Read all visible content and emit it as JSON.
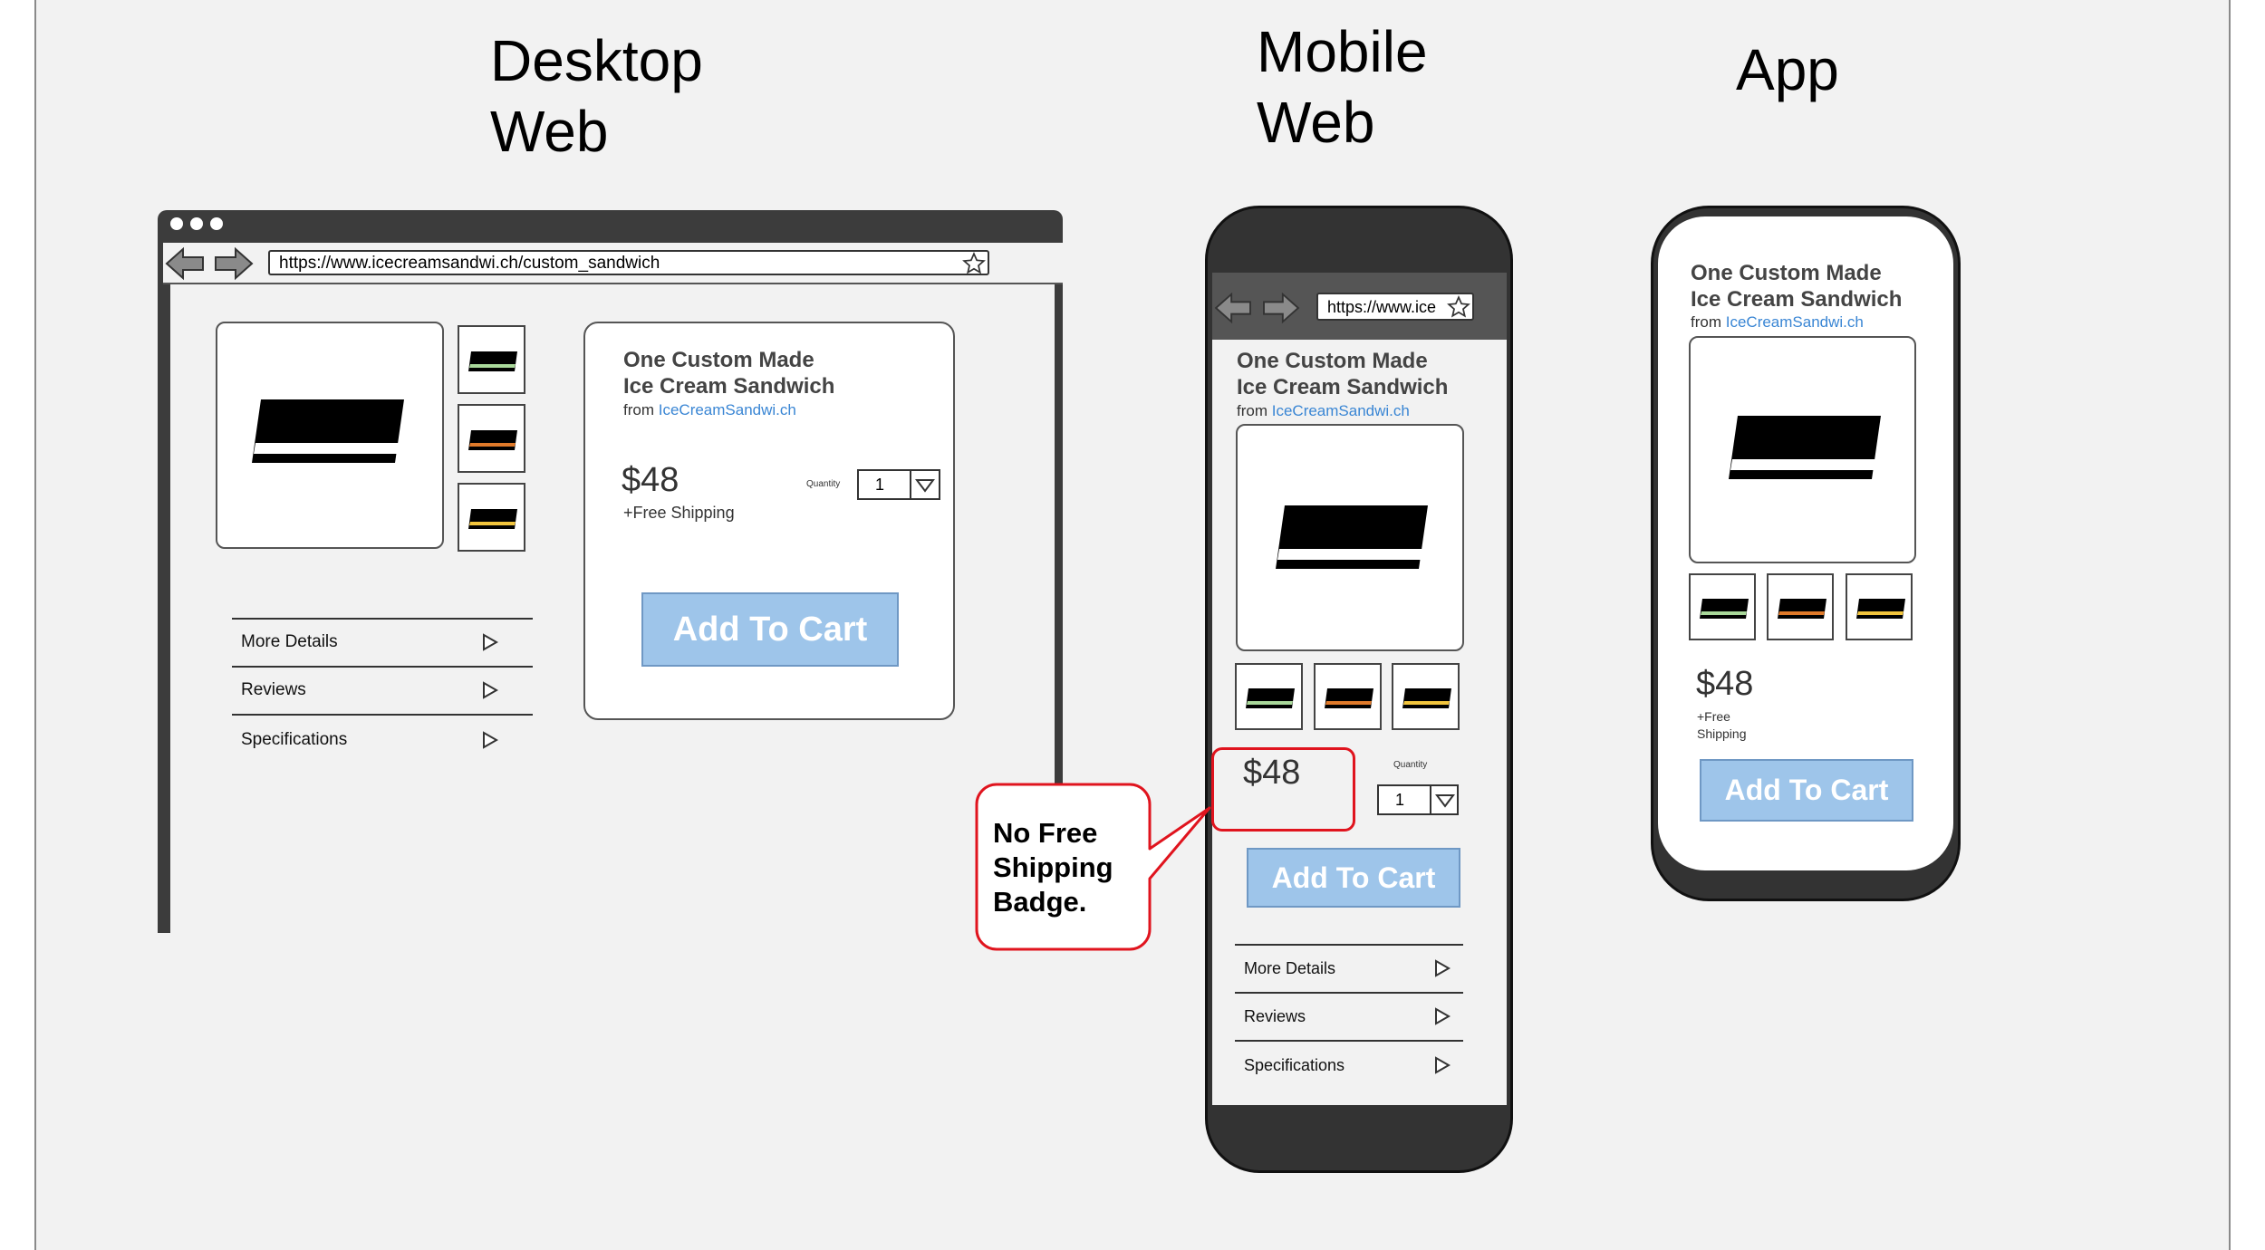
{
  "columns": {
    "desktop_heading": "Desktop\nWeb",
    "mobile_heading": "Mobile\nWeb",
    "app_heading": "App"
  },
  "product": {
    "title": "One Custom Made\nIce Cream Sandwich",
    "from_prefix": "from",
    "brand_link": "IceCreamSandwi.ch",
    "price": "$48",
    "shipping": "+Free Shipping",
    "shipping_app": "+Free\nShipping",
    "add_to_cart": "Add To Cart",
    "quantity_label": "Quantity",
    "quantity_value": "1"
  },
  "browser": {
    "desktop_url": "https://www.icecreamsandwi.ch/custom_sandwich",
    "mobile_url": "https://www.ice"
  },
  "accordion": [
    "More Details",
    "Reviews",
    "Specifications"
  ],
  "callout": {
    "text": "No Free\nShipping\nBadge.",
    "color": "#e0141e"
  },
  "colors": {
    "cta_fill": "#9ec5ea",
    "link": "#3a86d4",
    "thumb_stripes": [
      "#a9d89a",
      "#e07a2a",
      "#f2c53d"
    ]
  }
}
